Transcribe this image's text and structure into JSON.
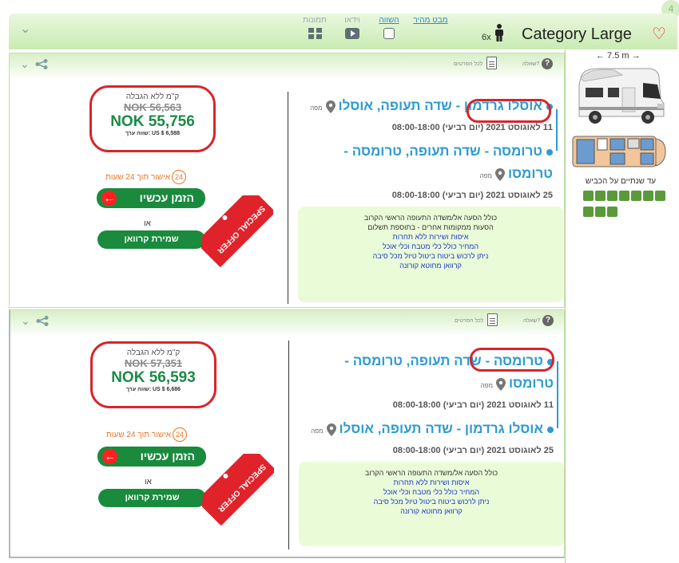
{
  "header": {
    "category_title": "Category Large",
    "passengers": "6x",
    "corner_badge": "4",
    "tools": {
      "quick_view": "מבט מהיר",
      "compare": "השווה",
      "video": "וידאו",
      "photos": "תמונות"
    }
  },
  "vehicle": {
    "length": "← 7.5 m →",
    "sleeps_note": "עד שנתיים על הכביש"
  },
  "card_labels": {
    "question": "שאלה?",
    "details": "לכל הפרטים",
    "map": "מפה",
    "km_label": "ק\"מ ללא הגבלה",
    "approval": "אישור תוך 24 שעות",
    "approval_hours": "24",
    "book_now": "הזמן עכשיו",
    "or": "או",
    "save_camper": "שמירת קרוואן",
    "special_offer": "SPECIAL OFFER"
  },
  "results": [
    {
      "pickup_location": "אוסלו גרדמון - שדה תעופה, אוסלו",
      "pickup_date": "11 לאוגוסט 2021 (יום רביעי) 08:00-18:00",
      "dropoff_location": "טרומסה - שדה תעופה, טרומסה - טרומסו",
      "dropoff_date": "25 לאוגוסט 2021 (יום רביעי) 08:00-18:00",
      "old_price": "NOK 56,563",
      "new_price": "NOK 55,756",
      "usd_value": "שווה ערך: US $ 6,588",
      "features": [
        {
          "text": "כולל הסעה אל/משדה התעופה הראשי הקרוב",
          "style": "plain"
        },
        {
          "text": "הסעות ממקומות אחרים - בתוספת תשלום",
          "style": "plain"
        },
        {
          "text": "איסות ושירות ללא תחרות",
          "style": "blue"
        },
        {
          "text": "המחיר כולל כלי מטבח וכלי אוכל",
          "style": "blue"
        },
        {
          "text": "ניתן לרכוש ביטוח ביטול טיול מכל סיבה",
          "style": "blue"
        },
        {
          "text": "קרוואן מחוטא קורונה",
          "style": "blue"
        }
      ]
    },
    {
      "pickup_location": "טרומסה - שדה תעופה, טרומסה - טרומסו",
      "pickup_date": "11 לאוגוסט 2021 (יום רביעי) 08:00-18:00",
      "dropoff_location": "אוסלו גרדמון - שדה תעופה, אוסלו",
      "dropoff_date": "25 לאוגוסט 2021 (יום רביעי) 08:00-18:00",
      "old_price": "NOK 57,351",
      "new_price": "NOK 56,593",
      "usd_value": "שווה ערך: US $ 6,686",
      "features": [
        {
          "text": "כולל הסעה אל/משדה התעופה הראשי הקרוב",
          "style": "plain"
        },
        {
          "text": "איסות ושירות ללא תחרות",
          "style": "blue"
        },
        {
          "text": "המחיר כולל כלי מטבח וכלי אוכל",
          "style": "blue"
        },
        {
          "text": "ניתן לרכוש ביטוח ביטול טיול מכל סיבה",
          "style": "blue"
        },
        {
          "text": "קרוואן מחוטא קורונה",
          "style": "blue"
        }
      ]
    }
  ],
  "colors": {
    "accent_blue": "#2d9bd1",
    "price_green": "#1b8a44",
    "highlight_red": "#d6262c",
    "approval_orange": "#e87526"
  }
}
